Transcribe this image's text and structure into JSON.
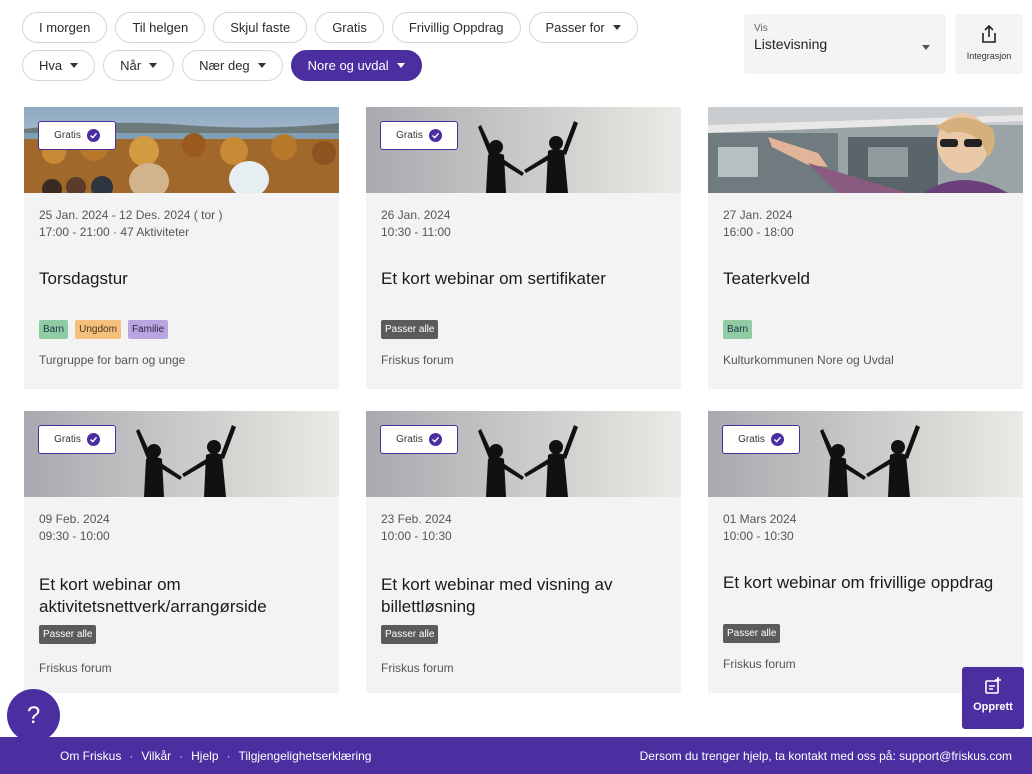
{
  "filters": {
    "row1": [
      {
        "label": "I morgen",
        "dropdown": false
      },
      {
        "label": "Til helgen",
        "dropdown": false
      },
      {
        "label": "Skjul faste",
        "dropdown": false
      },
      {
        "label": "Gratis",
        "dropdown": false
      },
      {
        "label": "Frivillig Oppdrag",
        "dropdown": false
      },
      {
        "label": "Passer for",
        "dropdown": true
      }
    ],
    "row2": [
      {
        "label": "Hva",
        "dropdown": true
      },
      {
        "label": "Når",
        "dropdown": true
      },
      {
        "label": "Nær deg",
        "dropdown": true
      },
      {
        "label": "Nore og uvdal",
        "dropdown": true,
        "active": true
      }
    ]
  },
  "view": {
    "label": "Vis",
    "value": "Listevisning"
  },
  "integrasjon": {
    "label": "Integrasjon",
    "icon": "share-icon"
  },
  "cards": [
    {
      "badge": "Gratis",
      "image": "forest-lake-landscape",
      "date": "25 Jan. 2024 - 12 Des. 2024 ( tor )",
      "time": "17:00 - 21:00  ·  47 Aktiviteter",
      "title": "Torsdagstur",
      "tags": [
        {
          "label": "Barn",
          "kind": "barn"
        },
        {
          "label": "Ungdom",
          "kind": "ungdom"
        },
        {
          "label": "Familie",
          "kind": "familie"
        }
      ],
      "org": "Turgruppe for barn og unge"
    },
    {
      "badge": "Gratis",
      "image": "silhouettes",
      "date": "26 Jan. 2024",
      "time": "10:30 - 11:00",
      "title": "Et kort webinar om sertifikater",
      "tags": [
        {
          "label": "Passer alle",
          "kind": "passer"
        }
      ],
      "org": "Friskus forum"
    },
    {
      "badge": "",
      "image": "woman-pointing",
      "date": "27 Jan. 2024",
      "time": "16:00 - 18:00",
      "title": "Teaterkveld",
      "tags": [
        {
          "label": "Barn",
          "kind": "barn"
        }
      ],
      "org": "Kulturkommunen Nore og Uvdal"
    },
    {
      "badge": "Gratis",
      "image": "silhouettes",
      "date": "09 Feb. 2024",
      "time": "09:30 - 10:00",
      "title": "Et kort webinar om aktivitetsnettverk/arrangørside",
      "tags": [
        {
          "label": "Passer alle",
          "kind": "passer"
        }
      ],
      "org": "Friskus forum"
    },
    {
      "badge": "Gratis",
      "image": "silhouettes",
      "date": "23 Feb. 2024",
      "time": "10:00 - 10:30",
      "title": "Et kort webinar med visning av billettløsning",
      "tags": [
        {
          "label": "Passer alle",
          "kind": "passer"
        }
      ],
      "org": "Friskus forum"
    },
    {
      "badge": "Gratis",
      "image": "silhouettes",
      "date": "01 Mars 2024",
      "time": "10:00 - 10:30",
      "title": "Et kort webinar om frivillige oppdrag",
      "tags": [
        {
          "label": "Passer alle",
          "kind": "passer"
        }
      ],
      "org": "Friskus forum"
    }
  ],
  "help": {
    "label": "?"
  },
  "opprett": {
    "label": "Opprett"
  },
  "footer": {
    "links": [
      "Om Friskus",
      "Vilkår",
      "Hjelp",
      "Tilgjengelighetserklæring"
    ],
    "contact": "Dersom du trenger hjelp, ta kontakt med oss på: support@friskus.com"
  },
  "colors": {
    "accent": "#4b2fa0",
    "card_bg": "#f4f3f3"
  }
}
